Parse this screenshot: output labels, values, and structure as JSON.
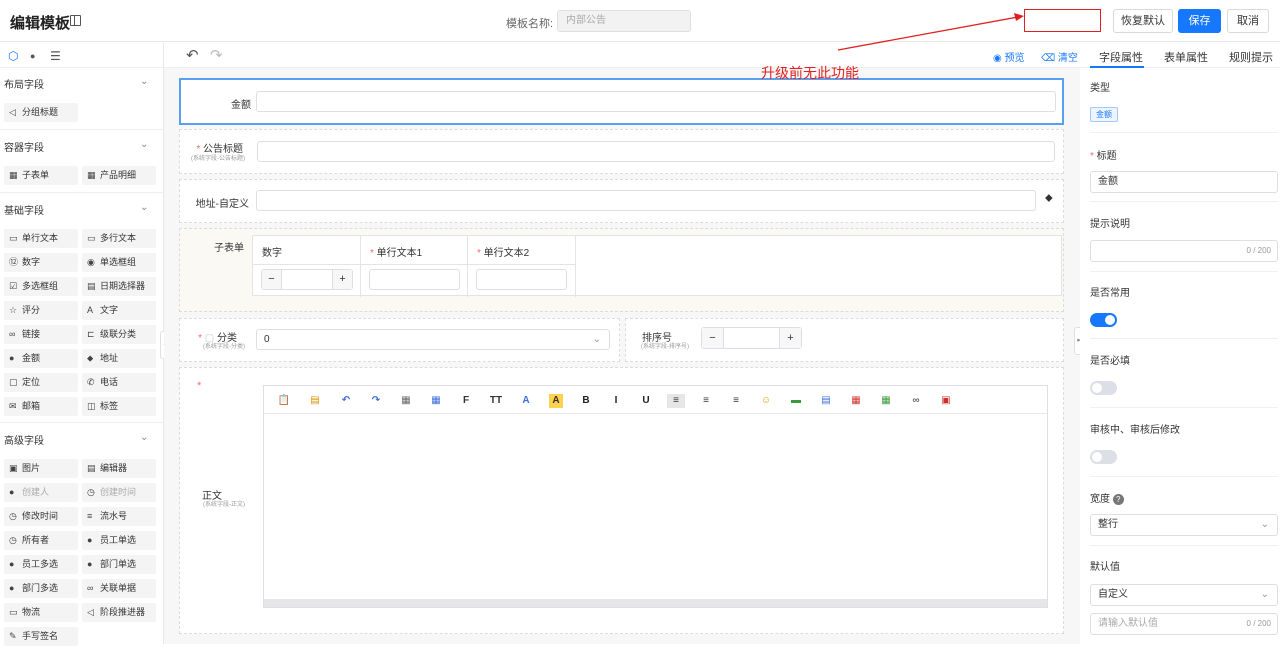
{
  "header": {
    "title": "编辑模板",
    "name_label": "模板名称:",
    "name_value": "内部公告",
    "restore_label": "恢复默认",
    "save_label": "保存",
    "cancel_label": "取消"
  },
  "annotation": "升级前无此功能",
  "left_panel": {
    "groups": [
      {
        "title": "布局字段",
        "items": [
          {
            "label": "分组标题",
            "icon": "◁"
          }
        ]
      },
      {
        "title": "容器字段",
        "items": [
          {
            "label": "子表单",
            "icon": "▦"
          },
          {
            "label": "产品明细",
            "icon": "▦"
          }
        ]
      },
      {
        "title": "基础字段",
        "items": [
          {
            "label": "单行文本",
            "icon": "▭"
          },
          {
            "label": "多行文本",
            "icon": "▭"
          },
          {
            "label": "数字",
            "icon": "⑫"
          },
          {
            "label": "单选框组",
            "icon": "◉"
          },
          {
            "label": "多选框组",
            "icon": "☑"
          },
          {
            "label": "日期选择器",
            "icon": "▤"
          },
          {
            "label": "评分",
            "icon": "☆"
          },
          {
            "label": "文字",
            "icon": "A"
          },
          {
            "label": "链接",
            "icon": "∞"
          },
          {
            "label": "级联分类",
            "icon": "⊏"
          },
          {
            "label": "金额",
            "icon": "●"
          },
          {
            "label": "地址",
            "icon": "⬥"
          },
          {
            "label": "定位",
            "icon": "▢"
          },
          {
            "label": "电话",
            "icon": "✆"
          },
          {
            "label": "邮箱",
            "icon": "✉"
          },
          {
            "label": "标签",
            "icon": "◫"
          }
        ]
      },
      {
        "title": "高级字段",
        "items": [
          {
            "label": "图片",
            "icon": "▣"
          },
          {
            "label": "编辑器",
            "icon": "▤"
          },
          {
            "label": "创建人",
            "icon": "●",
            "disabled": true
          },
          {
            "label": "创建时间",
            "icon": "◷",
            "disabled": true
          },
          {
            "label": "修改时间",
            "icon": "◷"
          },
          {
            "label": "流水号",
            "icon": "≡"
          },
          {
            "label": "所有者",
            "icon": "◷"
          },
          {
            "label": "员工单选",
            "icon": "●"
          },
          {
            "label": "员工多选",
            "icon": "●"
          },
          {
            "label": "部门单选",
            "icon": "●"
          },
          {
            "label": "部门多选",
            "icon": "●"
          },
          {
            "label": "关联单据",
            "icon": "∞"
          },
          {
            "label": "物流",
            "icon": "▭"
          },
          {
            "label": "阶段推进器",
            "icon": "◁"
          },
          {
            "label": "手写签名",
            "icon": "✎"
          }
        ]
      }
    ]
  },
  "toolbar": {
    "preview_label": "预览",
    "clear_label": "清空"
  },
  "form": {
    "amount_label": "金额",
    "title_label": "公告标题",
    "title_sub": "(系统字段-公告标题)",
    "address_label": "地址-自定义",
    "subform_label": "子表单",
    "subform_cols": [
      "数字",
      "单行文本1",
      "单行文本2"
    ],
    "category_label": "分类",
    "category_sub": "(系统字段-分类)",
    "category_value": "0",
    "sort_label": "排序号",
    "sort_sub": "(系统字段-排序号)",
    "body_label": "正文",
    "body_sub": "(系统字段-正文)",
    "stepper_minus": "−",
    "stepper_plus": "+"
  },
  "right_panel": {
    "tabs": [
      "字段属性",
      "表单属性",
      "规则提示"
    ],
    "type_label": "类型",
    "type_value": "金额",
    "title_label": "标题",
    "title_value": "金额",
    "hint_label": "提示说明",
    "hint_counter": "0 / 200",
    "common_label": "是否常用",
    "common_on": true,
    "required_label": "是否必填",
    "required_on": false,
    "modify_label": "审核中、审核后修改",
    "modify_on": false,
    "width_label": "宽度",
    "width_value": "整行",
    "default_label": "默认值",
    "default_value": "自定义",
    "default_placeholder": "请输入默认值",
    "default_counter": "0 / 200"
  }
}
